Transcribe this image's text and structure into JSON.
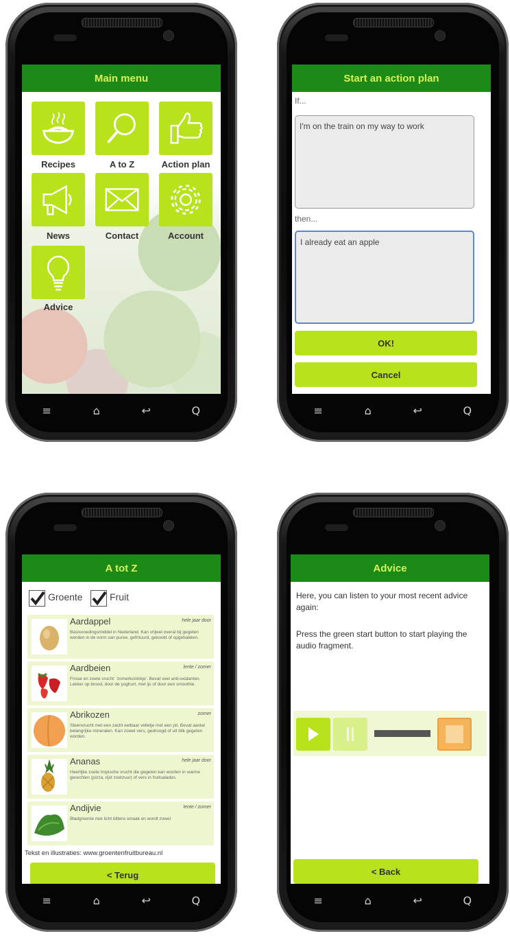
{
  "main_menu": {
    "title": "Main menu",
    "tiles": [
      {
        "label": "Recipes",
        "icon": "noodle-bowl-icon"
      },
      {
        "label": "A to Z",
        "icon": "magnifier-icon"
      },
      {
        "label": "Action plan",
        "icon": "thumbs-up-icon"
      },
      {
        "label": "News",
        "icon": "megaphone-icon"
      },
      {
        "label": "Contact",
        "icon": "envelope-icon"
      },
      {
        "label": "Account",
        "icon": "gear-icon"
      },
      {
        "label": "Advice",
        "icon": "lightbulb-icon"
      }
    ]
  },
  "action_plan": {
    "title": "Start an action plan",
    "if_label": "If...",
    "if_value": "I'm on the train on my way to work",
    "then_label": "then...",
    "then_value": "I already eat an apple",
    "ok_label": "OK!",
    "cancel_label": "Cancel"
  },
  "a_to_z": {
    "title": "A tot Z",
    "filters": [
      {
        "label": "Groente",
        "checked": true
      },
      {
        "label": "Fruit",
        "checked": true
      }
    ],
    "items": [
      {
        "name": "Aardappel",
        "season": "hele jaar door",
        "desc": "Basisvoedingsmiddel in Nederland. Kan vrijwel overal bij gegeten worden in de vorm van puree, gefrituurd, gekookt of opgebakken."
      },
      {
        "name": "Aardbeien",
        "season": "lente / zomer",
        "desc": "Frisse en zoete vrucht: 'zomerkoninkje'. Bevat veel anti-oxidanten. Lekker op brood, door de yoghurt, met ijs of door een smoothie."
      },
      {
        "name": "Abrikozen",
        "season": "zomer",
        "desc": "Steenvrucht met een zacht eetbaar velletje met een pit. Bevat aantal belangrijke mineralen. Kan zowel vers, gedroogd of uit blik gegeten worden."
      },
      {
        "name": "Ananas",
        "season": "hele jaar door",
        "desc": "Heerlijke zoete tropische vrucht die gegeten kan worden in warme gerechten (pizza, rijst zoetzuur) of vers in fruitsalades."
      },
      {
        "name": "Andijvie",
        "season": "lente / zomer",
        "desc": "Bladgroente met licht bittere smaak en wordt zowel"
      }
    ],
    "credit": "Tekst en illustraties: www.groentenfruitbureau.nl",
    "back_label": "< Terug"
  },
  "advice": {
    "title": "Advice",
    "text1": "Here, you can listen to your most recent advice again:",
    "text2": "Press the green start button to start playing the audio fragment.",
    "back_label": "< Back"
  },
  "navbar": {
    "menu": "≡",
    "home": "⌂",
    "back": "↩",
    "search": "Q"
  }
}
